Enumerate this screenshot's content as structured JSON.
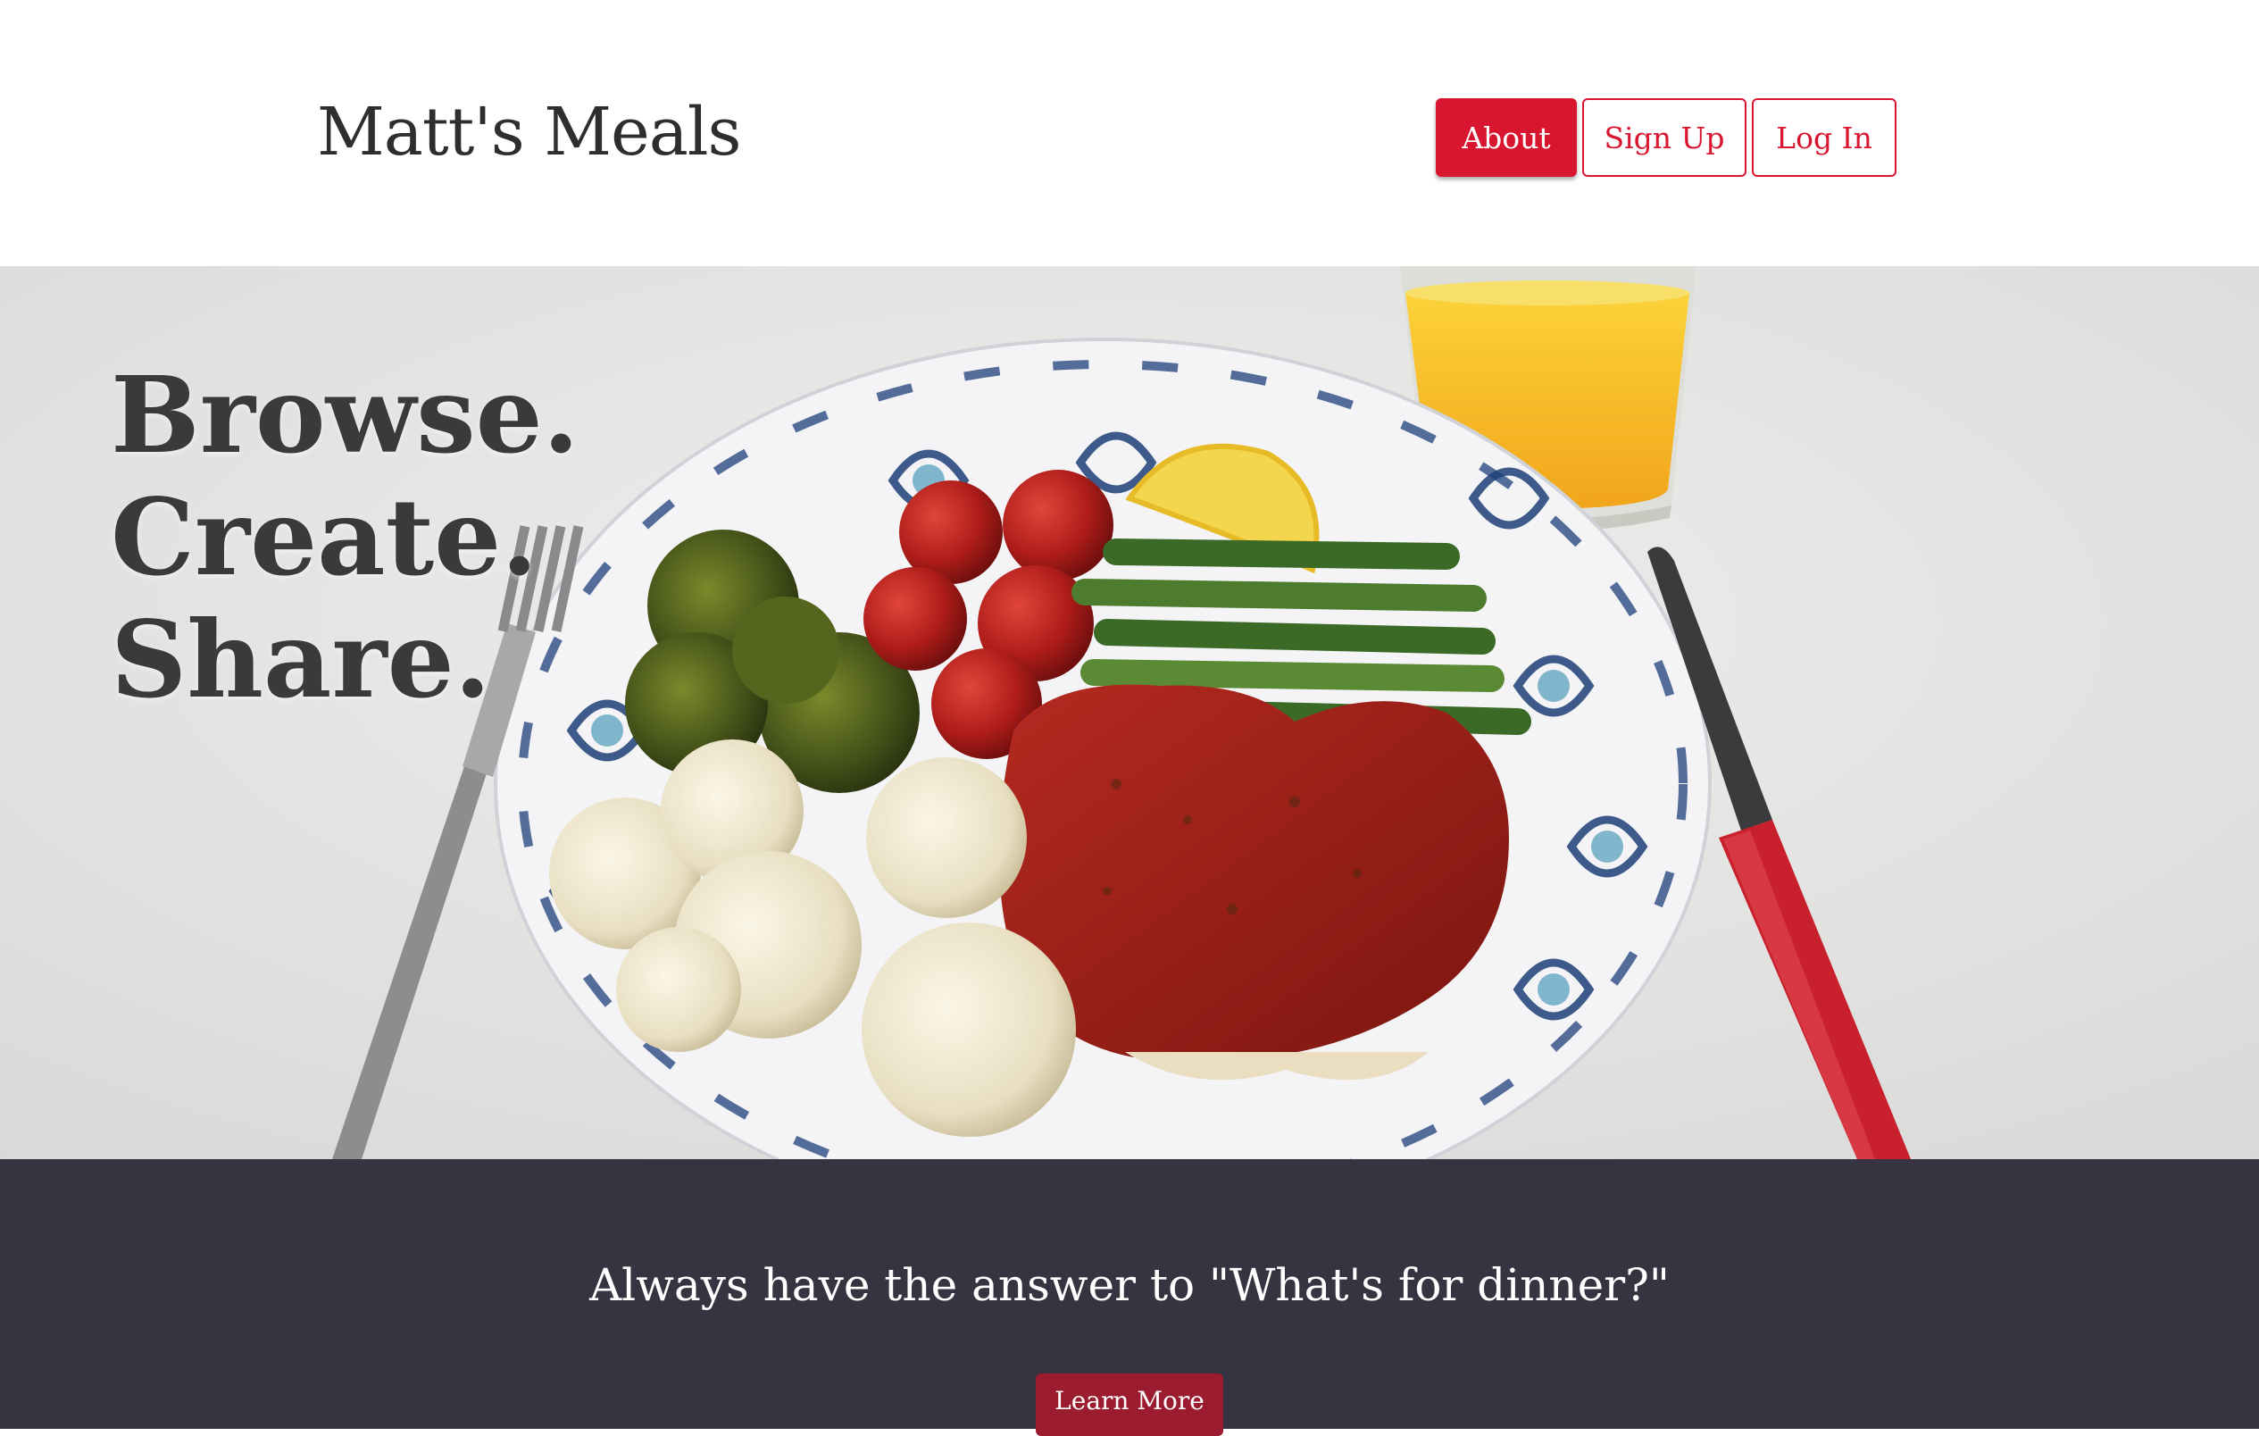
{
  "header": {
    "brand": "Matt's Meals",
    "nav": [
      {
        "label": "About",
        "active": true
      },
      {
        "label": "Sign Up",
        "active": false
      },
      {
        "label": "Log In",
        "active": false
      }
    ]
  },
  "hero": {
    "tagline": [
      "Browse.",
      "Create.",
      "Share."
    ]
  },
  "cta": {
    "text": "Always have the answer to \"What's for dinner?\"",
    "button_label": "Learn More"
  },
  "colors": {
    "accent": "#d9162f",
    "band": "#363440",
    "cta_button": "#9b1c2e"
  }
}
